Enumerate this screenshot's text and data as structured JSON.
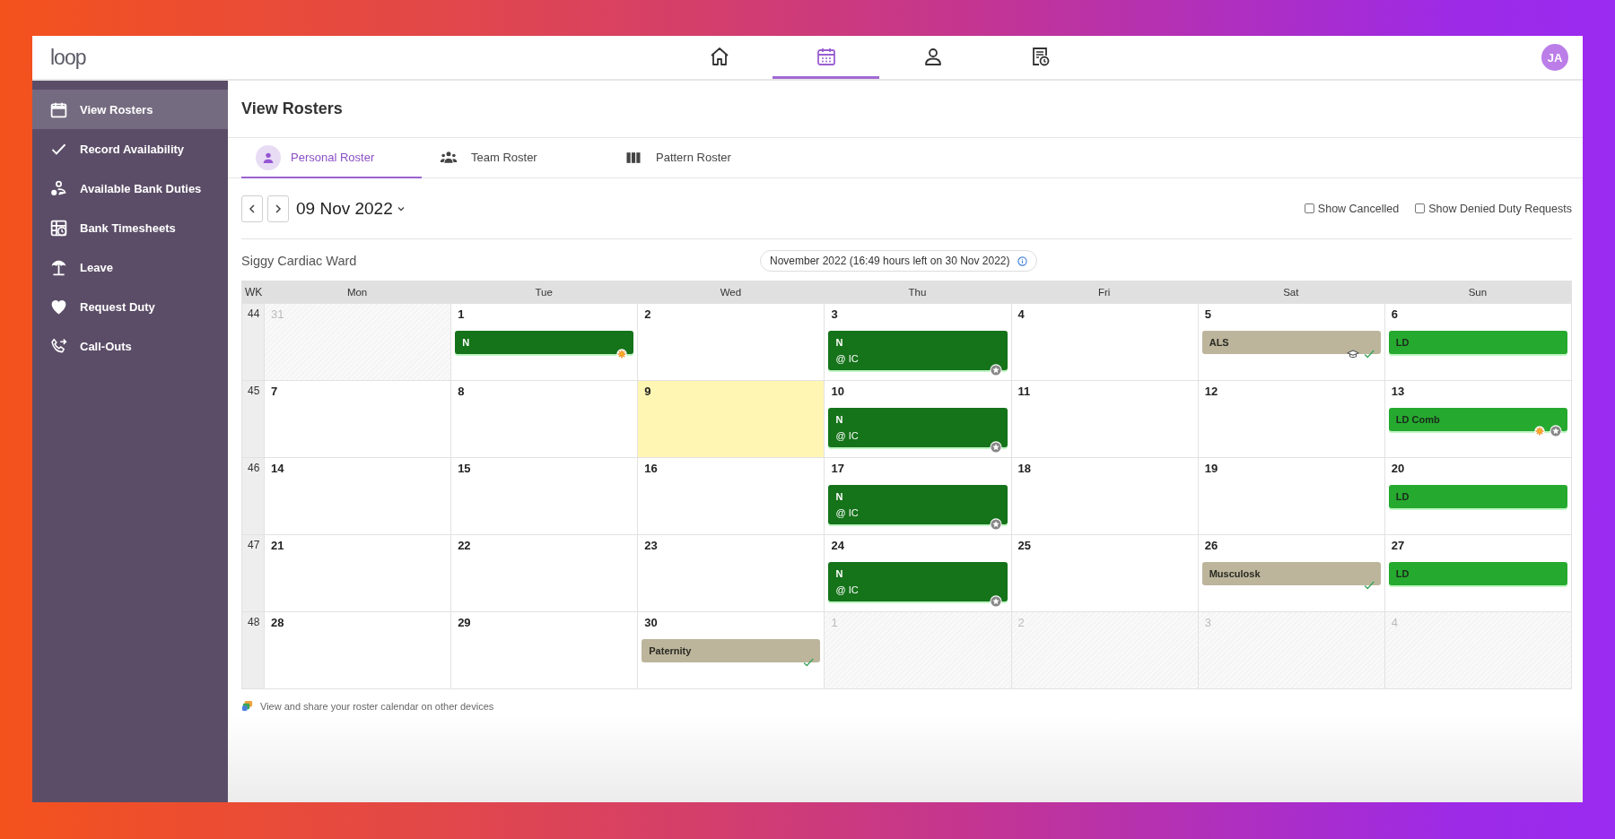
{
  "logo": "loop",
  "top_nav": [
    {
      "selected": false
    },
    {
      "selected": true
    },
    {
      "selected": false
    },
    {
      "selected": false
    }
  ],
  "avatar": "JA",
  "sidebar": {
    "items": [
      {
        "label": "View Rosters",
        "selected": true
      },
      {
        "label": "Record Availability",
        "selected": false
      },
      {
        "label": "Available Bank Duties",
        "selected": false
      },
      {
        "label": "Bank Timesheets",
        "selected": false
      },
      {
        "label": "Leave",
        "selected": false
      },
      {
        "label": "Request Duty",
        "selected": false
      },
      {
        "label": "Call-Outs",
        "selected": false
      }
    ]
  },
  "page_title": "View Rosters",
  "tabs": [
    {
      "label": "Personal Roster",
      "selected": true
    },
    {
      "label": "Team Roster",
      "selected": false
    },
    {
      "label": "Pattern Roster",
      "selected": false
    }
  ],
  "date": "09 Nov 2022",
  "filters": [
    {
      "label": "Show Cancelled",
      "checked": false
    },
    {
      "label": "Show Denied Duty Requests",
      "checked": false
    }
  ],
  "ward": "Siggy Cardiac Ward",
  "hours_note": "November 2022 (16:49 hours left on 30 Nov 2022)",
  "calendar": {
    "columns": [
      "WK",
      "Mon",
      "Tue",
      "Wed",
      "Thu",
      "Fri",
      "Sat",
      "Sun"
    ],
    "weeks": [
      {
        "week": "44",
        "days": [
          {
            "date": "31",
            "outside": true,
            "today": false
          },
          {
            "date": "1",
            "outside": false,
            "today": false,
            "duties": [
              {
                "kind": "night",
                "lines": [
                  "N"
                ],
                "flagged": true,
                "training": false,
                "approved": false,
                "starred": false
              }
            ]
          },
          {
            "date": "2",
            "outside": false,
            "today": false
          },
          {
            "date": "3",
            "outside": false,
            "today": false,
            "duties": [
              {
                "kind": "night",
                "lines": [
                  "N",
                  "@ IC"
                ],
                "flagged": false,
                "training": false,
                "approved": false,
                "starred": true
              }
            ]
          },
          {
            "date": "4",
            "outside": false,
            "today": false
          },
          {
            "date": "5",
            "outside": false,
            "today": false,
            "duties": [
              {
                "kind": "leave",
                "lines": [
                  "ALS"
                ],
                "flagged": false,
                "training": true,
                "approved": true,
                "starred": false
              }
            ]
          },
          {
            "date": "6",
            "outside": false,
            "today": false,
            "duties": [
              {
                "kind": "day",
                "lines": [
                  "LD"
                ],
                "flagged": false,
                "training": false,
                "approved": false,
                "starred": false
              }
            ]
          }
        ]
      },
      {
        "week": "45",
        "days": [
          {
            "date": "7",
            "outside": false,
            "today": false
          },
          {
            "date": "8",
            "outside": false,
            "today": false
          },
          {
            "date": "9",
            "outside": false,
            "today": true
          },
          {
            "date": "10",
            "outside": false,
            "today": false,
            "duties": [
              {
                "kind": "night",
                "lines": [
                  "N",
                  "@ IC"
                ],
                "flagged": false,
                "training": false,
                "approved": false,
                "starred": true
              }
            ]
          },
          {
            "date": "11",
            "outside": false,
            "today": false
          },
          {
            "date": "12",
            "outside": false,
            "today": false
          },
          {
            "date": "13",
            "outside": false,
            "today": false,
            "duties": [
              {
                "kind": "day",
                "lines": [
                  "LD Comb"
                ],
                "flagged": true,
                "training": false,
                "approved": false,
                "starred": true
              }
            ]
          }
        ]
      },
      {
        "week": "46",
        "days": [
          {
            "date": "14",
            "outside": false,
            "today": false
          },
          {
            "date": "15",
            "outside": false,
            "today": false
          },
          {
            "date": "16",
            "outside": false,
            "today": false
          },
          {
            "date": "17",
            "outside": false,
            "today": false,
            "duties": [
              {
                "kind": "night",
                "lines": [
                  "N",
                  "@ IC"
                ],
                "flagged": false,
                "training": false,
                "approved": false,
                "starred": true
              }
            ]
          },
          {
            "date": "18",
            "outside": false,
            "today": false
          },
          {
            "date": "19",
            "outside": false,
            "today": false
          },
          {
            "date": "20",
            "outside": false,
            "today": false,
            "duties": [
              {
                "kind": "day",
                "lines": [
                  "LD"
                ],
                "flagged": false,
                "training": false,
                "approved": false,
                "starred": false
              }
            ]
          }
        ]
      },
      {
        "week": "47",
        "days": [
          {
            "date": "21",
            "outside": false,
            "today": false
          },
          {
            "date": "22",
            "outside": false,
            "today": false
          },
          {
            "date": "23",
            "outside": false,
            "today": false
          },
          {
            "date": "24",
            "outside": false,
            "today": false,
            "duties": [
              {
                "kind": "night",
                "lines": [
                  "N",
                  "@ IC"
                ],
                "flagged": false,
                "training": false,
                "approved": false,
                "starred": true
              }
            ]
          },
          {
            "date": "25",
            "outside": false,
            "today": false
          },
          {
            "date": "26",
            "outside": false,
            "today": false,
            "duties": [
              {
                "kind": "leave",
                "lines": [
                  "Musculosk"
                ],
                "flagged": false,
                "training": false,
                "approved": true,
                "starred": false
              }
            ]
          },
          {
            "date": "27",
            "outside": false,
            "today": false,
            "duties": [
              {
                "kind": "day",
                "lines": [
                  "LD"
                ],
                "flagged": false,
                "training": false,
                "approved": false,
                "starred": false
              }
            ]
          }
        ]
      },
      {
        "week": "48",
        "days": [
          {
            "date": "28",
            "outside": false,
            "today": false
          },
          {
            "date": "29",
            "outside": false,
            "today": false
          },
          {
            "date": "30",
            "outside": false,
            "today": false,
            "duties": [
              {
                "kind": "leave",
                "lines": [
                  "Paternity"
                ],
                "flagged": false,
                "training": false,
                "approved": true,
                "starred": false
              }
            ]
          },
          {
            "date": "1",
            "outside": true,
            "today": false
          },
          {
            "date": "2",
            "outside": true,
            "today": false
          },
          {
            "date": "3",
            "outside": true,
            "today": false
          },
          {
            "date": "4",
            "outside": true,
            "today": false
          }
        ]
      }
    ]
  },
  "footer_link": "View and share your roster calendar on other devices"
}
